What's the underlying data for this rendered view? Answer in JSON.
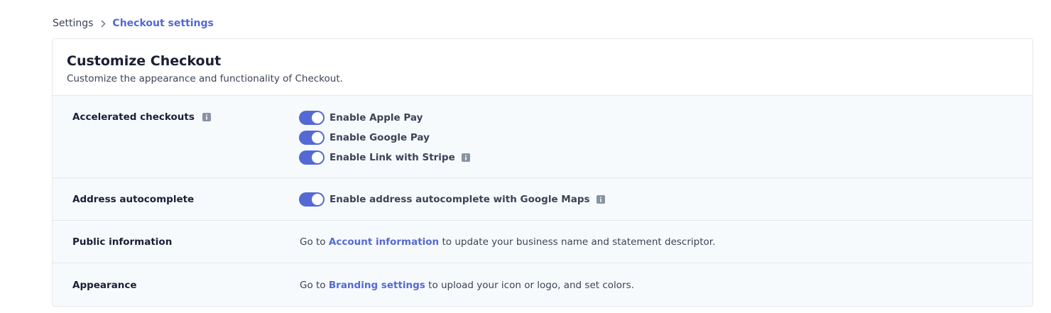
{
  "breadcrumb": {
    "root": "Settings",
    "current": "Checkout settings"
  },
  "card": {
    "title": "Customize Checkout",
    "subtitle": "Customize the appearance and functionality of Checkout."
  },
  "rows": [
    {
      "label": "Accelerated checkouts",
      "toggles": [
        {
          "label": "Enable Apple Pay",
          "enabled": true
        },
        {
          "label": "Enable Google Pay",
          "enabled": true
        },
        {
          "label": "Enable Link with Stripe",
          "enabled": true
        }
      ]
    },
    {
      "label": "Address autocomplete",
      "toggles": [
        {
          "label": "Enable address autocomplete with Google Maps",
          "enabled": true
        }
      ]
    },
    {
      "label": "Public information",
      "prefix": "Go to",
      "link": "Account information",
      "suffix": "to update your business name and statement descriptor."
    },
    {
      "label": "Appearance",
      "prefix": "Go to",
      "link": "Branding settings",
      "suffix": "to upload your icon or logo, and set colors."
    }
  ],
  "colors": {
    "accent": "#5469d4",
    "row_background": "#f7fafc",
    "border": "#e3e8ee",
    "info_icon": "#8792a2"
  },
  "icons": {
    "breadcrumb_separator": "chevron-right-icon",
    "info": "info-icon"
  }
}
